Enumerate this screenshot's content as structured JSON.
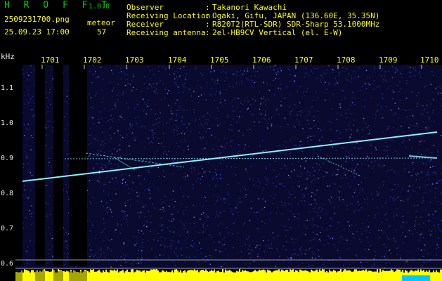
{
  "app": {
    "title": "H R O F F T",
    "version": "1.0.0",
    "filename": "2509231700.png",
    "datetime": "25.09.23 17:00",
    "meteor_label": "meteor",
    "meteor_count": "57"
  },
  "info": {
    "labels": [
      "Observer",
      "Receiving Location",
      "Receiver",
      "Receiving antenna"
    ],
    "colons": [
      ":",
      ":",
      ":",
      ":"
    ],
    "values": [
      "Takanori Kawachi",
      "Ogaki, Gifu, JAPAN (136.60E, 35.35N)",
      "R820T2(RTL-SDR) SDR-Sharp 53.1000MHz",
      "2el-HB9CV Vertical (el. E-W)"
    ]
  },
  "axis": {
    "unit": "kHz",
    "time_ticks": [
      "1701",
      "1702",
      "1703",
      "1704",
      "1705",
      "1706",
      "1707",
      "1708",
      "1709",
      "1710"
    ],
    "freq_ticks": [
      "1.1",
      "1.0",
      "0.9",
      "0.8",
      "0.7",
      "0.6"
    ]
  },
  "colors": {
    "background": "#0a0a2e",
    "noise_dots": "#3d44d8",
    "dark_bands": "#000000",
    "meteor_trace": "#8af0ff",
    "text_yellow": "#ffff00",
    "text_green": "#00d000",
    "text_white": "#e8e8e8",
    "bottom_bar": "#ffff00",
    "bottom_bar_alt": "#00c8ff"
  }
}
